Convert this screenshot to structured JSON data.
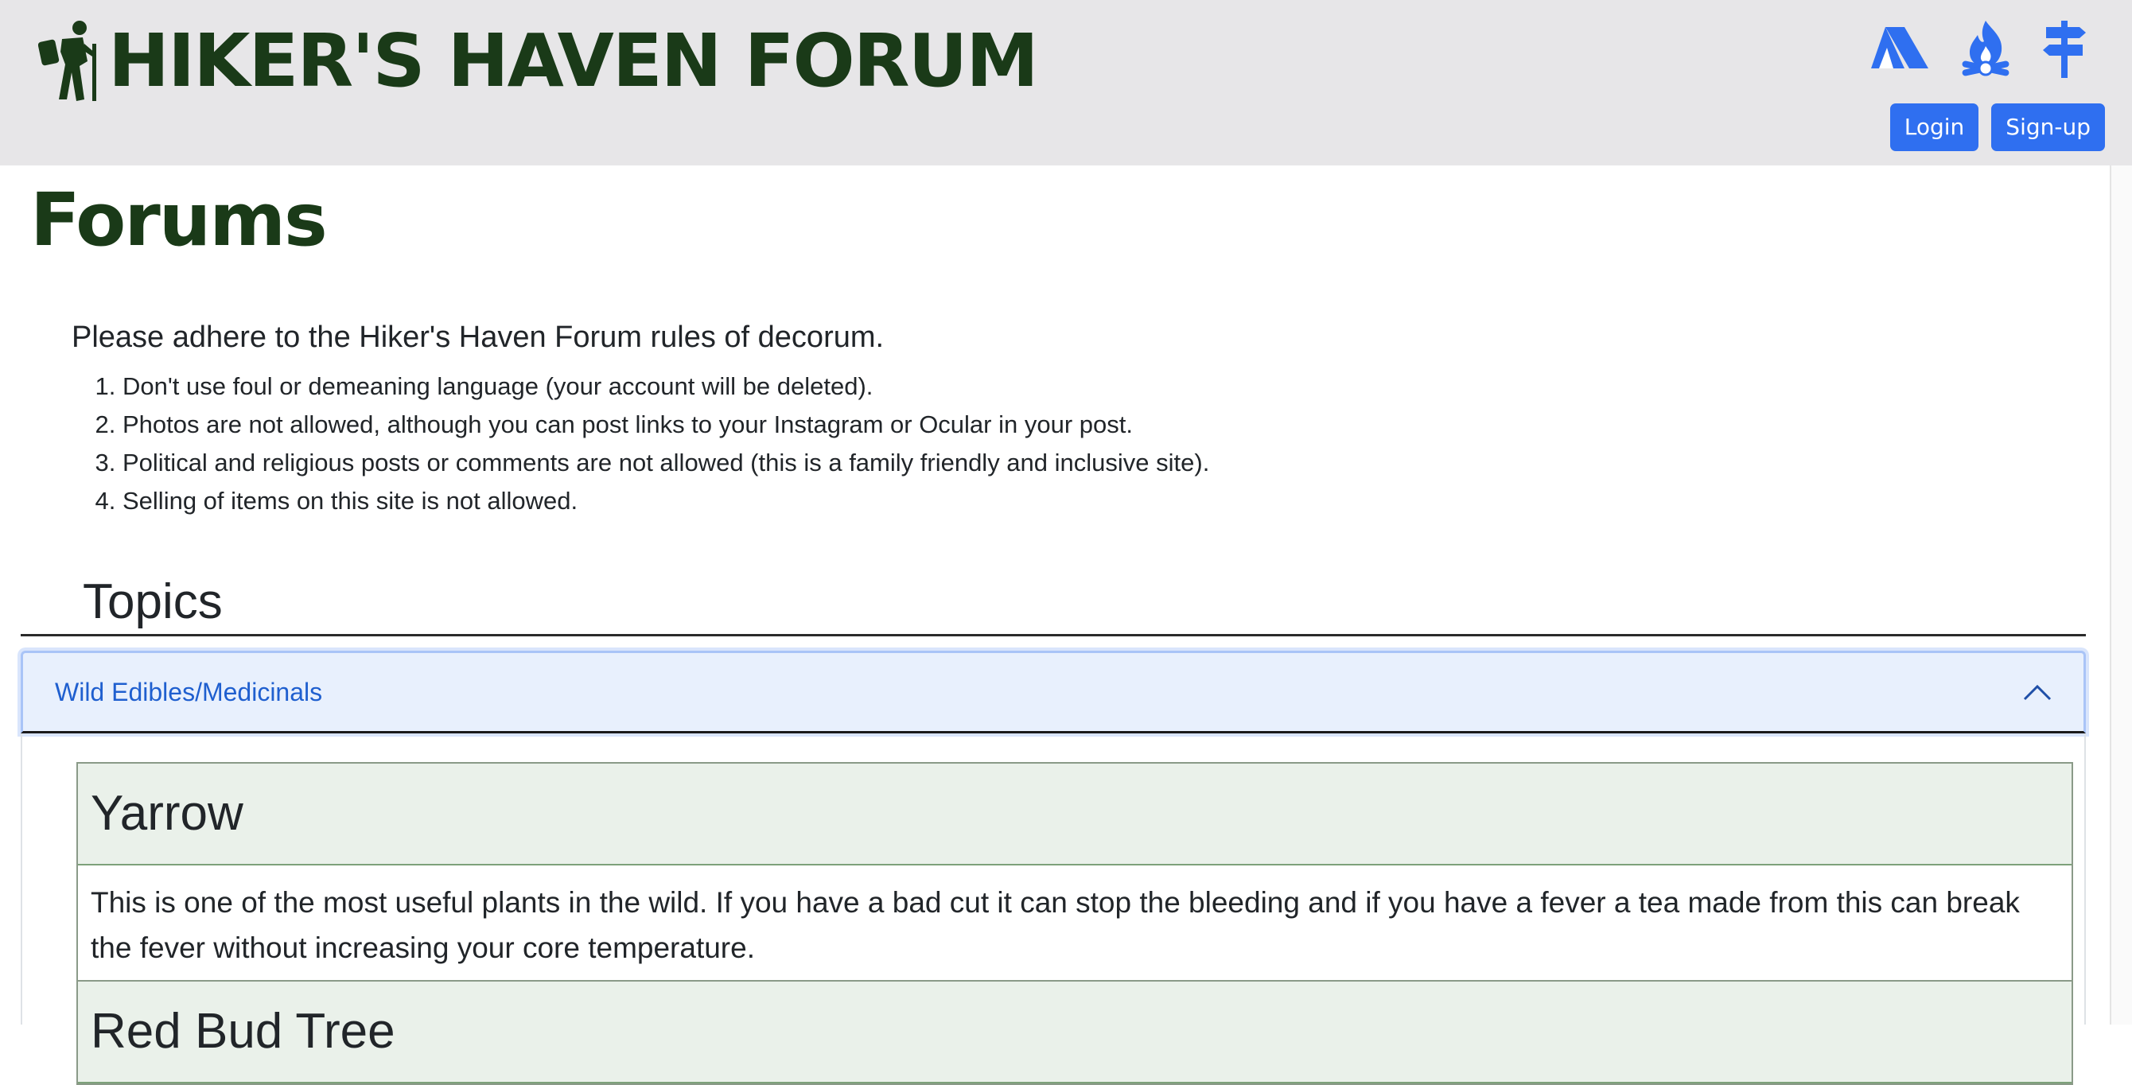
{
  "header": {
    "brand_title": "HIKER'S HAVEN FORUM",
    "icons": [
      "hiker-icon",
      "tent-icon",
      "campfire-icon",
      "signpost-icon"
    ],
    "login_label": "Login",
    "signup_label": "Sign-up"
  },
  "main": {
    "page_title": "Forums",
    "rules_intro": "Please adhere to the Hiker's Haven Forum rules of decorum.",
    "rules": [
      "Don't use foul or demeaning language (your account will be deleted).",
      "Photos are not allowed, although you can post links to your Instagram or Ocular in your post.",
      "Political and religious posts or comments are not allowed (this is a family friendly and inclusive site).",
      "Selling of items on this site is not allowed."
    ],
    "topics_title": "Topics",
    "accordion": {
      "label": "Wild Edibles/Medicinals",
      "expanded": true,
      "toggle_icon": "chevron-up-icon"
    },
    "posts": [
      {
        "title": "Yarrow",
        "body": "This is one of the most useful plants in the wild. If you have a bad cut it can stop the bleeding and if you have a fever a tea made from this can break the fever without increasing your core temperature."
      },
      {
        "title": "Red Bud Tree",
        "body": ""
      }
    ]
  },
  "colors": {
    "brand_green": "#1a3a18",
    "accent_blue": "#2f6ff0",
    "header_bg": "#e7e6e8",
    "card_header_bg": "#eaf1ea",
    "accordion_bg": "#e8f0fd"
  }
}
